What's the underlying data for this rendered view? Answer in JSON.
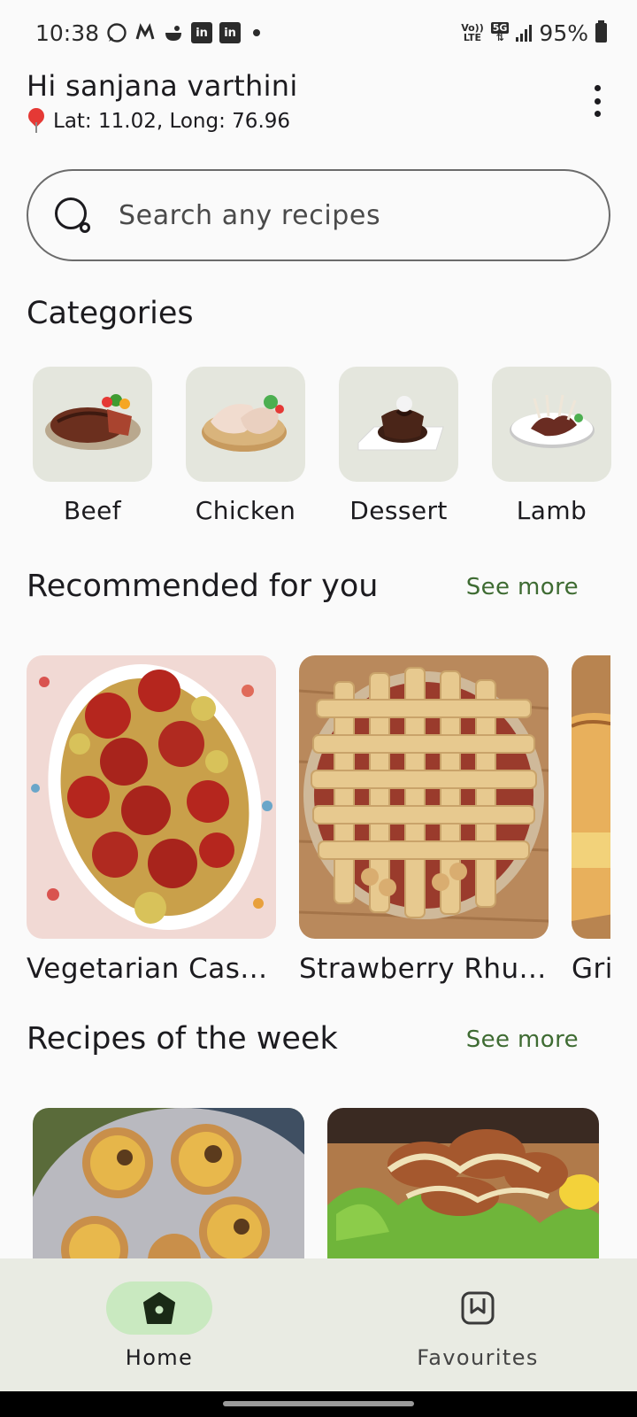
{
  "status_bar": {
    "time": "10:38",
    "notification_icons": [
      "whatsapp-icon",
      "myntra-icon",
      "cloud-app-icon",
      "linkedin-icon",
      "linkedin-icon"
    ],
    "network_tag_top": "Vo))",
    "network_tag_bottom": "LTE",
    "network_type": "5G",
    "battery": "95%"
  },
  "header": {
    "greeting": "Hi sanjana varthini",
    "location": "Lat: 11.02, Long: 76.96"
  },
  "search": {
    "placeholder": "Search any recipes"
  },
  "categories": {
    "title": "Categories",
    "items": [
      {
        "label": "Beef"
      },
      {
        "label": "Chicken"
      },
      {
        "label": "Dessert"
      },
      {
        "label": "Lamb"
      }
    ]
  },
  "recommended": {
    "title": "Recommended for you",
    "see_more": "See more",
    "items": [
      {
        "title": "Vegetarian Cas..."
      },
      {
        "title": "Strawberry Rhu..."
      },
      {
        "title": "Gri"
      }
    ]
  },
  "week": {
    "title": "Recipes of the week",
    "see_more": "See more"
  },
  "bottom_nav": {
    "items": [
      {
        "label": "Home",
        "icon": "home-icon",
        "active": true
      },
      {
        "label": "Favourites",
        "icon": "bookmark-icon",
        "active": false
      }
    ]
  },
  "colors": {
    "accent_green": "#3e6b32",
    "active_pill": "#c9e9c0",
    "nav_background": "#e9ebe3",
    "category_tile": "#e4e6dd"
  }
}
